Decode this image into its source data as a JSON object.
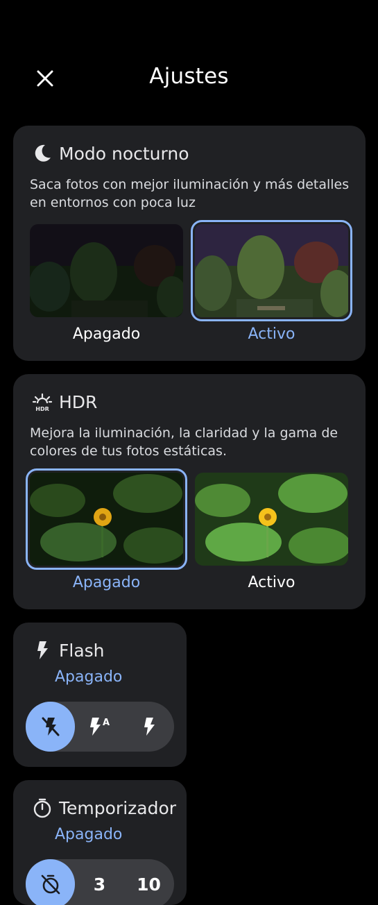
{
  "header": {
    "title": "Ajustes",
    "close_icon": "close-icon"
  },
  "night_mode": {
    "icon": "moon-icon",
    "title": "Modo nocturno",
    "description": "Saca fotos con mejor iluminación y más detalles en entornos con poca luz",
    "options": [
      {
        "label": "Apagado",
        "selected": false
      },
      {
        "label": "Activo",
        "selected": true
      }
    ]
  },
  "hdr": {
    "icon": "hdr-icon",
    "title": "HDR",
    "description": "Mejora la iluminación, la claridad y la gama de colores de tus fotos estáticas.",
    "options": [
      {
        "label": "Apagado",
        "selected": true
      },
      {
        "label": "Activo",
        "selected": false
      }
    ]
  },
  "flash": {
    "icon": "flash-icon",
    "title": "Flash",
    "status": "Apagado",
    "options": [
      {
        "icon": "flash-off-icon",
        "selected": true
      },
      {
        "icon": "flash-auto-icon",
        "selected": false
      },
      {
        "icon": "flash-on-icon",
        "selected": false
      }
    ]
  },
  "timer": {
    "icon": "timer-icon",
    "title": "Temporizador",
    "status": "Apagado",
    "options": [
      {
        "icon": "timer-off-icon",
        "selected": true
      },
      {
        "label": "3",
        "selected": false
      },
      {
        "label": "10",
        "selected": false
      }
    ]
  },
  "colors": {
    "accent": "#8ab4f8",
    "card": "#202124",
    "background": "#000000"
  }
}
